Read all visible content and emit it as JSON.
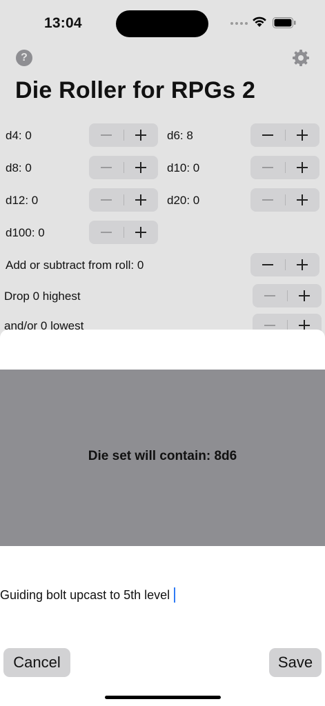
{
  "status": {
    "time": "13:04"
  },
  "header": {
    "help_symbol": "?",
    "title": "Die Roller for RPGs 2"
  },
  "dice": {
    "d4": "d4: 0",
    "d6": "d6: 8",
    "d8": "d8: 0",
    "d10": "d10: 0",
    "d12": "d12: 0",
    "d20": "d20: 0",
    "d100": "d100: 0"
  },
  "modifier": {
    "label": "Add or subtract from roll: 0"
  },
  "drop": {
    "highest": "Drop 0 highest",
    "lowest": "and/or 0 lowest"
  },
  "sheet": {
    "preview_text": "Die set will contain: 8d6",
    "name_value": "Guiding bolt upcast to 5th level",
    "cancel_label": "Cancel",
    "save_label": "Save"
  },
  "colors": {
    "accent": "#2f7bf5",
    "background": "#e3e3e3",
    "preview": "#8e8e92",
    "button": "#d2d2d4"
  },
  "icons": [
    "wifi-icon",
    "battery-icon",
    "help-icon",
    "gear-icon",
    "minus-icon",
    "plus-icon"
  ]
}
